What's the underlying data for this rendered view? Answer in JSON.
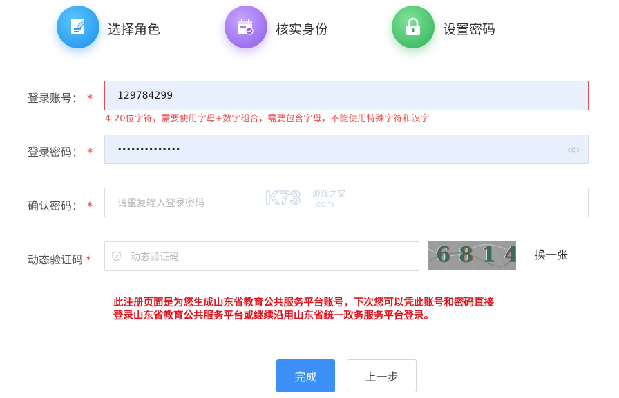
{
  "steps": [
    {
      "label": "选择角色",
      "icon": "edit-document-icon",
      "color": "#2f9ff0"
    },
    {
      "label": "核实身份",
      "icon": "calendar-check-icon",
      "color": "#9b6ef0"
    },
    {
      "label": "设置密码",
      "icon": "lock-icon",
      "color": "#3ec06a"
    }
  ],
  "form": {
    "account": {
      "label": "登录账号：",
      "required": "*",
      "value": "129784299",
      "hint": "4-20位字符，需要使用字母+数字组合，需要包含字母，不能使用特殊字符和汉字"
    },
    "password": {
      "label": "登录密码：",
      "required": "*",
      "value": "••••••••••••••"
    },
    "confirm": {
      "label": "确认密码：",
      "required": "*",
      "placeholder": "请重复输入登录密码"
    },
    "captcha": {
      "label": "动态验证码",
      "required": "*",
      "placeholder": "动态验证码",
      "image_text": "6814",
      "refresh_label": "换一张"
    }
  },
  "notice": "此注册页面是为您生成山东省教育公共服务平台账号，下次您可以凭此账号和密码直接登录山东省教育公共服务平台或继续沿用山东省统一政务服务平台登录。",
  "buttons": {
    "submit": "完成",
    "back": "上一步"
  },
  "watermark": {
    "logo": "K73",
    "sub": "游戏之家",
    "domain": ".com"
  },
  "colors": {
    "primary": "#3b8ff5",
    "error": "#e84c4c",
    "notice": "#e0141e",
    "filled_bg": "#e8effd"
  }
}
